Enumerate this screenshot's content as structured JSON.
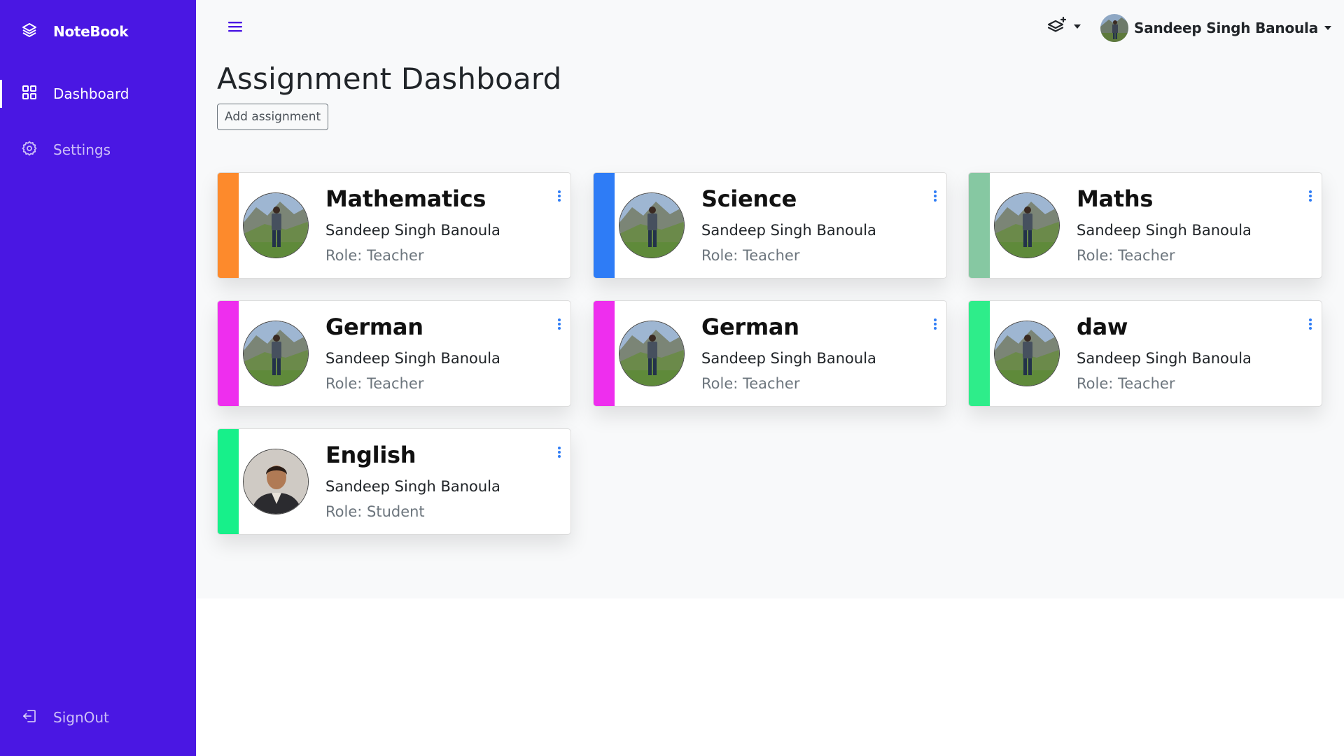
{
  "app": {
    "brand": "NoteBook"
  },
  "sidebar": {
    "items": [
      {
        "label": "Dashboard",
        "icon": "grid-icon",
        "active": true
      },
      {
        "label": "Settings",
        "icon": "gear-icon",
        "active": false
      }
    ],
    "signout": {
      "label": "SignOut",
      "icon": "signout-icon"
    }
  },
  "topbar": {
    "user_name": "Sandeep Singh Banoula"
  },
  "page": {
    "title": "Assignment Dashboard",
    "add_button": "Add assignment"
  },
  "cards": [
    {
      "title": "Mathematics",
      "owner": "Sandeep Singh Banoula",
      "role": "Role: Teacher",
      "color": "#FD8A2C",
      "avatar": "landscape"
    },
    {
      "title": "Science",
      "owner": "Sandeep Singh Banoula",
      "role": "Role: Teacher",
      "color": "#2E7CF6",
      "avatar": "landscape"
    },
    {
      "title": "Maths",
      "owner": "Sandeep Singh Banoula",
      "role": "Role: Teacher",
      "color": "#86C8A2",
      "avatar": "landscape"
    },
    {
      "title": "German",
      "owner": "Sandeep Singh Banoula",
      "role": "Role: Teacher",
      "color": "#EE2EEE",
      "avatar": "landscape"
    },
    {
      "title": "German",
      "owner": "Sandeep Singh Banoula",
      "role": "Role: Teacher",
      "color": "#EE2EEE",
      "avatar": "landscape"
    },
    {
      "title": "daw",
      "owner": "Sandeep Singh Banoula",
      "role": "Role: Teacher",
      "color": "#2EED8A",
      "avatar": "landscape"
    },
    {
      "title": "English",
      "owner": "Sandeep Singh Banoula",
      "role": "Role: Student",
      "color": "#17F08A",
      "avatar": "portrait"
    }
  ]
}
